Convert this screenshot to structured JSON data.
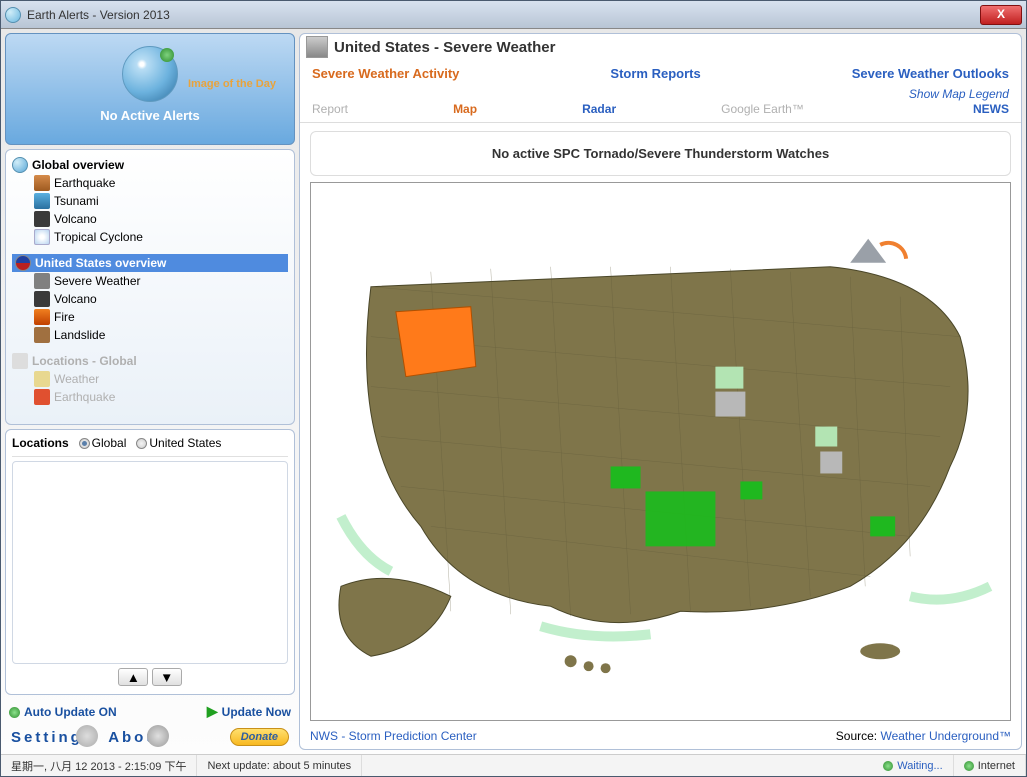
{
  "window": {
    "title": "Earth Alerts - Version 2013"
  },
  "hero": {
    "iotd": "Image of the Day",
    "alerts_status": "No Active Alerts"
  },
  "tree": {
    "global": {
      "head": "Global overview",
      "items": [
        {
          "label": "Earthquake"
        },
        {
          "label": "Tsunami"
        },
        {
          "label": "Volcano"
        },
        {
          "label": "Tropical Cyclone"
        }
      ]
    },
    "us": {
      "head": "United States overview",
      "items": [
        {
          "label": "Severe Weather"
        },
        {
          "label": "Volcano"
        },
        {
          "label": "Fire"
        },
        {
          "label": "Landslide"
        }
      ]
    },
    "locglobal": {
      "head": "Locations - Global",
      "items": [
        {
          "label": "Weather"
        },
        {
          "label": "Earthquake"
        }
      ]
    }
  },
  "locations": {
    "title": "Locations",
    "radio_global": "Global",
    "radio_us": "United States"
  },
  "controls": {
    "auto_update": "Auto Update ON",
    "update_now": "Update Now",
    "settings": "Settings",
    "about": "About",
    "donate": "Donate"
  },
  "main": {
    "title": "United States - Severe Weather",
    "tabs1": {
      "a": "Severe Weather Activity",
      "b": "Storm Reports",
      "c": "Severe Weather Outlooks"
    },
    "legend": "Show Map Legend",
    "tabs2": {
      "report": "Report",
      "map": "Map",
      "radar": "Radar",
      "ge": "Google Earth™",
      "news": "NEWS"
    },
    "banner": "No active SPC Tornado/Severe Thunderstorm Watches",
    "footer_left": "NWS - Storm Prediction Center",
    "footer_src_label": "Source:",
    "footer_src": "Weather Underground™"
  },
  "status": {
    "datetime": "星期一, 八月 12 2013 - 2:15:09 下午",
    "next": "Next update: about 5 minutes",
    "waiting": "Waiting...",
    "net": "Internet"
  }
}
